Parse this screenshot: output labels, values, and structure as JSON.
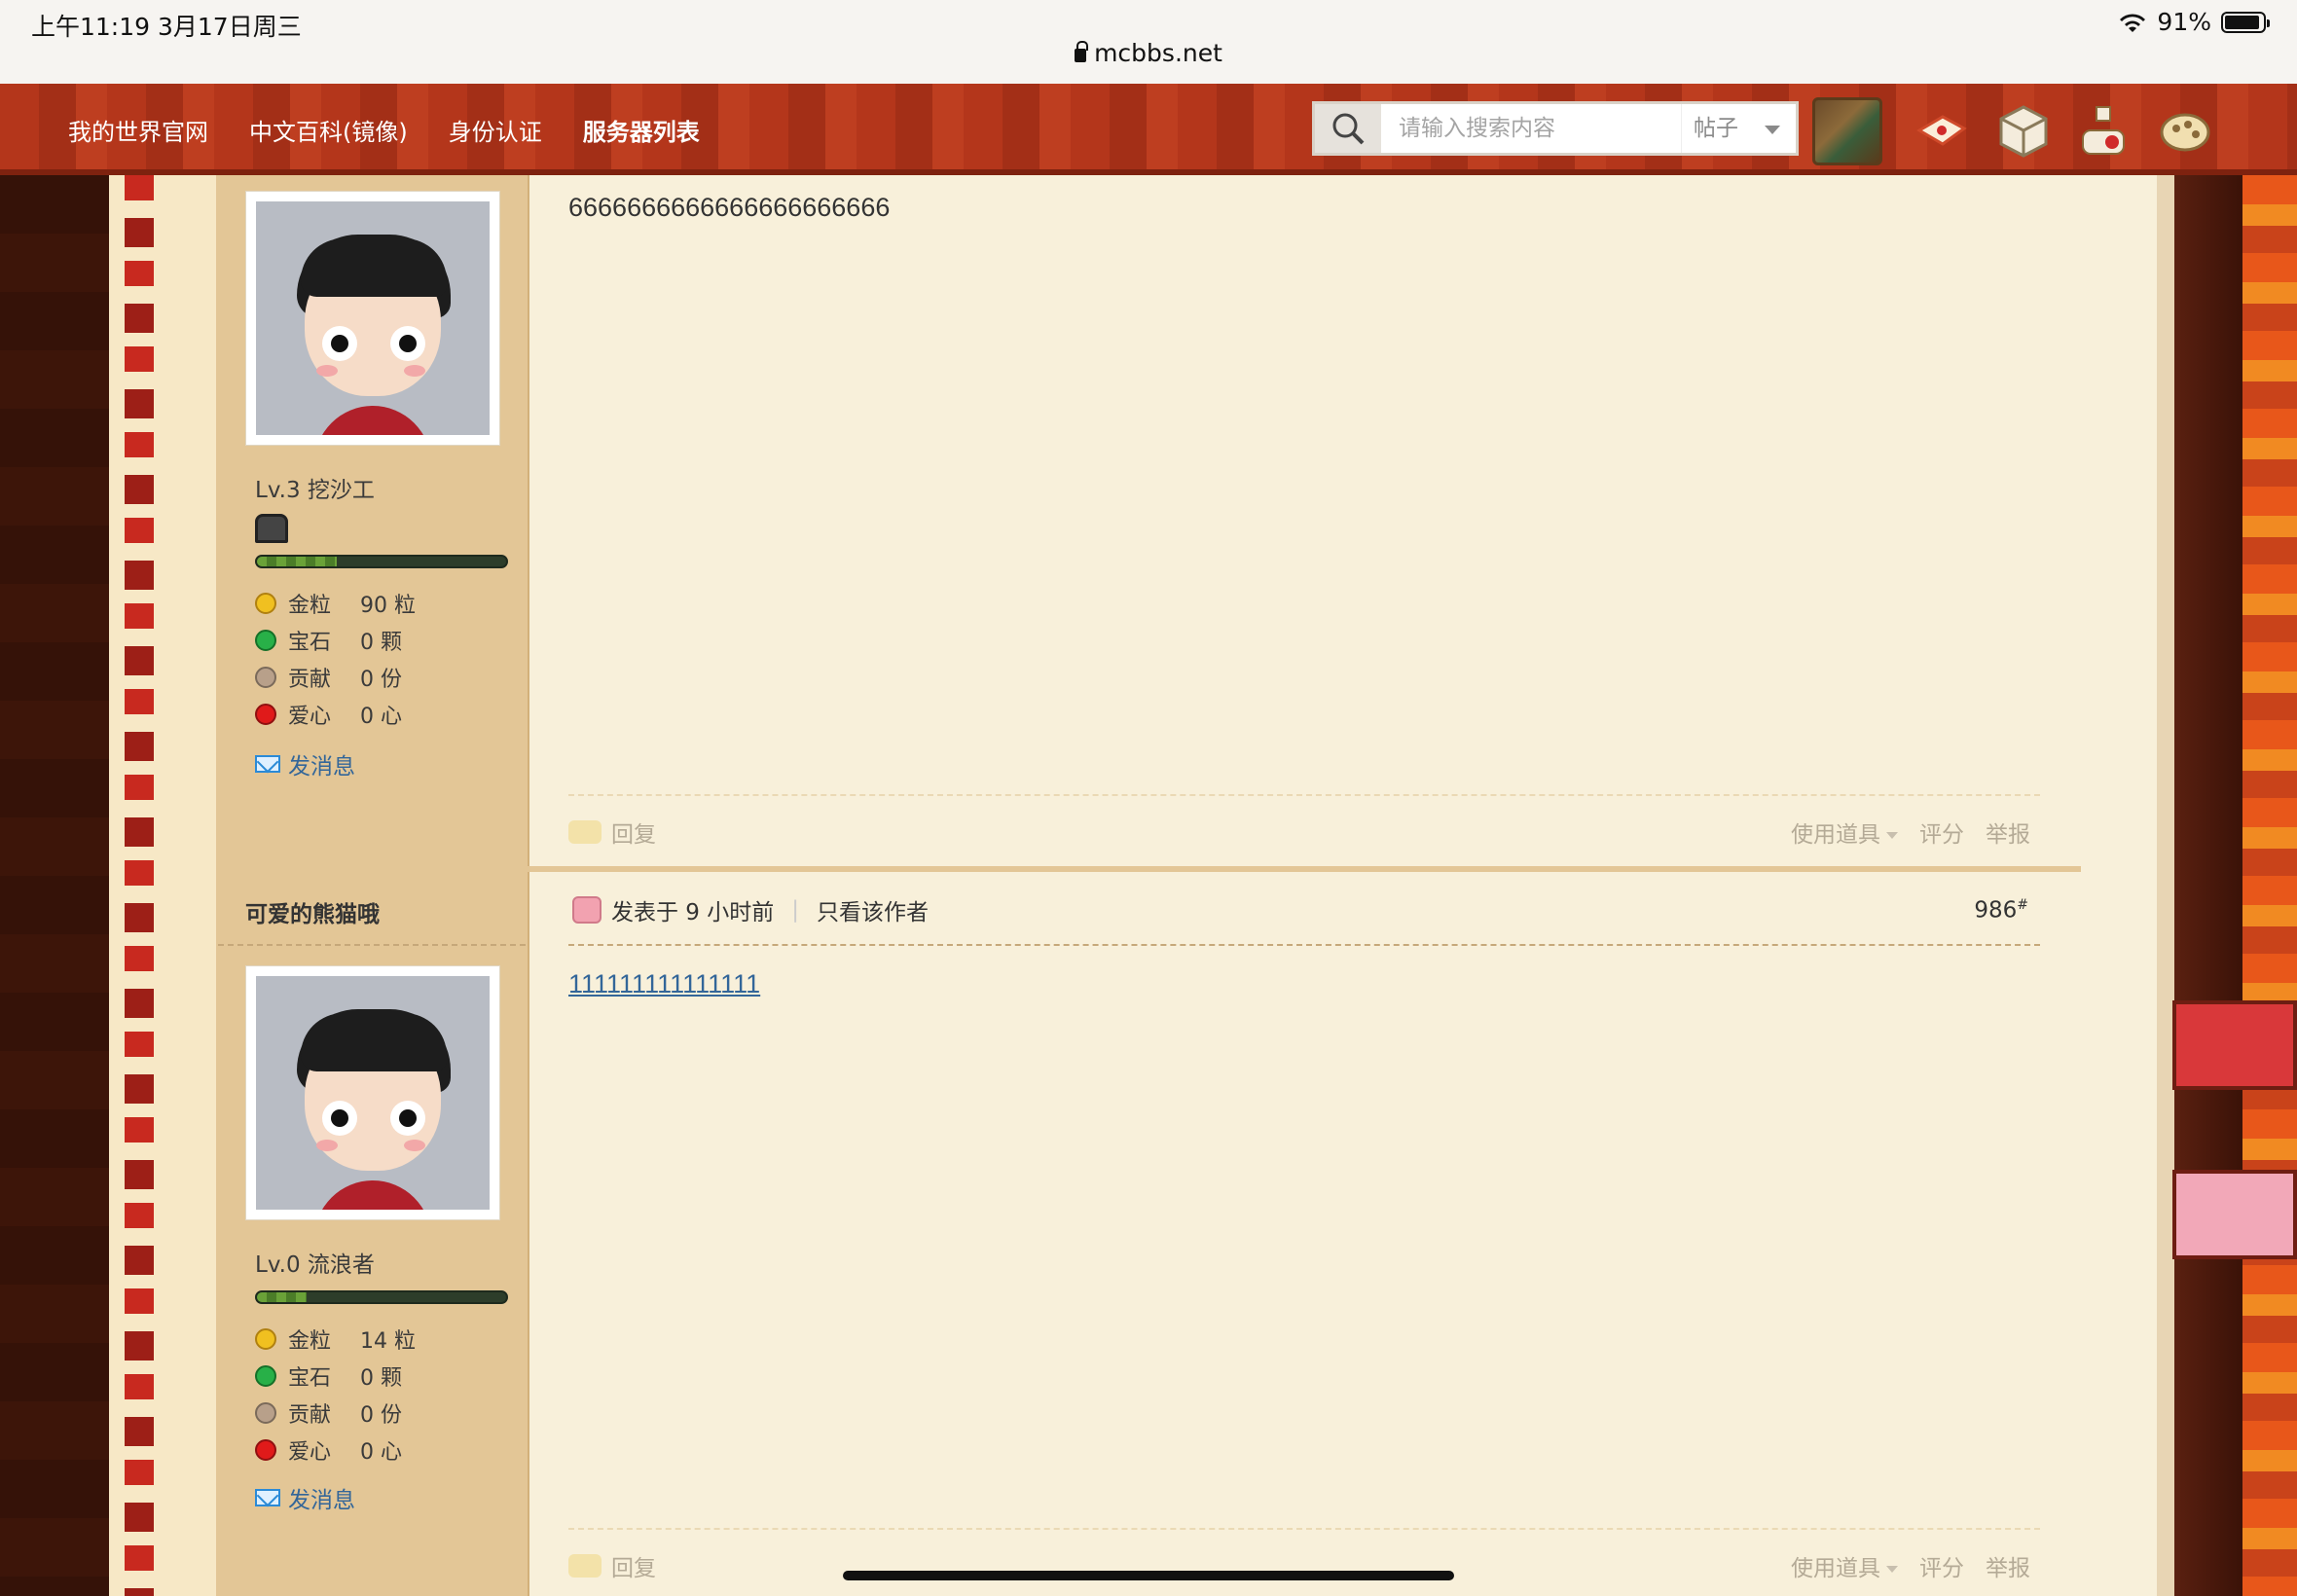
{
  "status_bar": {
    "time": "上午11:19   3月17日周三",
    "battery": "91%",
    "battery_level": 0.91,
    "url": "mcbbs.net"
  },
  "nav": {
    "links": [
      "我的世界官网",
      "中文百科(镜像)",
      "身份认证",
      "服务器列表"
    ],
    "search_placeholder": "请输入搜索内容",
    "search_type": "帖子"
  },
  "post1": {
    "user": {
      "level": "Lv.3 挖沙工",
      "progress": 0.32,
      "stats": [
        {
          "label": "金粒",
          "value": "90 粒"
        },
        {
          "label": "宝石",
          "value": "0 颗"
        },
        {
          "label": "贡献",
          "value": "0 份"
        },
        {
          "label": "爱心",
          "value": "0 心"
        }
      ],
      "send_message": "发消息"
    },
    "content": "6666666666666666666666",
    "actions": {
      "reply": "回复",
      "use_item": "使用道具",
      "rate": "评分",
      "report": "举报"
    }
  },
  "post2": {
    "username": "可爱的熊猫哦",
    "posted": "发表于 9 小时前",
    "only_author": "只看该作者",
    "floor": "986",
    "floor_mark": "#",
    "user": {
      "level": "Lv.0 流浪者",
      "progress": 0.2,
      "stats": [
        {
          "label": "金粒",
          "value": "14 粒"
        },
        {
          "label": "宝石",
          "value": "0 颗"
        },
        {
          "label": "贡献",
          "value": "0 份"
        },
        {
          "label": "爱心",
          "value": "0 心"
        }
      ],
      "send_message": "发消息"
    },
    "content": "111111111111111",
    "actions": {
      "reply": "回复",
      "use_item": "使用道具",
      "rate": "评分",
      "report": "举报"
    }
  },
  "colors": {
    "nav_red": "#b4361b",
    "sidebar_tan": "#e3c696",
    "content_bg": "#f8f0da",
    "link_blue": "#336699"
  }
}
